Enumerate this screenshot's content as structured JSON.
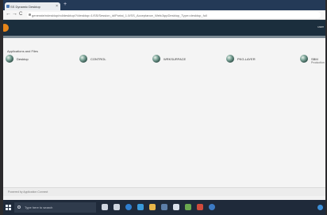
{
  "browser": {
    "tab_title": "SS Dynamic Desktop",
    "tab_close": "×",
    "new_tab": "+",
    "url": "generate/ndesktop/nd/desktop/?/desktop=1/SS/Session_id/Portal_1.0/SS_Acceptance_Web/AppDesktop_Type=desktop_full"
  },
  "nav": {
    "back": "←",
    "forward": "→",
    "reload": "C"
  },
  "appbar": {
    "user": "user"
  },
  "main": {
    "section_title": "Applications and Files",
    "apps": [
      {
        "label": "Desktop",
        "sub": ""
      },
      {
        "label": "CONTROL",
        "sub": ""
      },
      {
        "label": "WRKSURFACE",
        "sub": ""
      },
      {
        "label": "PKG-LAYER",
        "sub": ""
      },
      {
        "label": "SBM",
        "sub": "Production"
      }
    ]
  },
  "footer": {
    "text": "Powered by Application Connect"
  },
  "taskbar": {
    "search_placeholder": "Type here to search",
    "icon_colors": [
      "#cfd6e0",
      "#cfd6e0",
      "#2f7fd0",
      "#3a9ad9",
      "#e8b64a",
      "#5c7ea8",
      "#d9e0ea",
      "#6aa84f",
      "#d04b3c",
      "#3d7bc4"
    ]
  }
}
